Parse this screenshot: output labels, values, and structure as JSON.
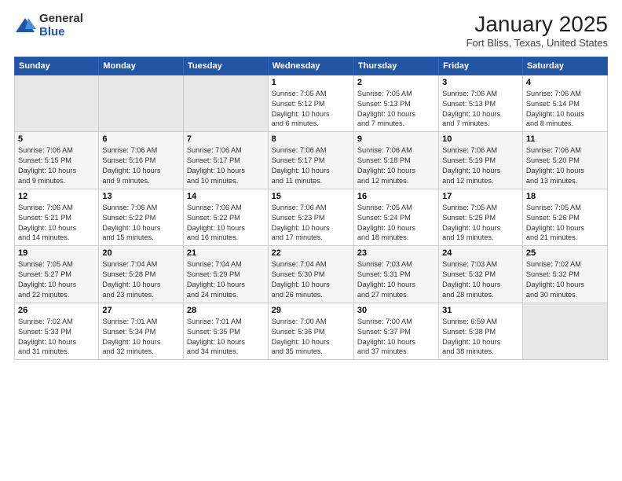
{
  "logo": {
    "general": "General",
    "blue": "Blue"
  },
  "title": "January 2025",
  "subtitle": "Fort Bliss, Texas, United States",
  "weekdays": [
    "Sunday",
    "Monday",
    "Tuesday",
    "Wednesday",
    "Thursday",
    "Friday",
    "Saturday"
  ],
  "weeks": [
    [
      {
        "num": "",
        "info": ""
      },
      {
        "num": "",
        "info": ""
      },
      {
        "num": "",
        "info": ""
      },
      {
        "num": "1",
        "info": "Sunrise: 7:05 AM\nSunset: 5:12 PM\nDaylight: 10 hours\nand 6 minutes."
      },
      {
        "num": "2",
        "info": "Sunrise: 7:05 AM\nSunset: 5:13 PM\nDaylight: 10 hours\nand 7 minutes."
      },
      {
        "num": "3",
        "info": "Sunrise: 7:06 AM\nSunset: 5:13 PM\nDaylight: 10 hours\nand 7 minutes."
      },
      {
        "num": "4",
        "info": "Sunrise: 7:06 AM\nSunset: 5:14 PM\nDaylight: 10 hours\nand 8 minutes."
      }
    ],
    [
      {
        "num": "5",
        "info": "Sunrise: 7:06 AM\nSunset: 5:15 PM\nDaylight: 10 hours\nand 9 minutes."
      },
      {
        "num": "6",
        "info": "Sunrise: 7:06 AM\nSunset: 5:16 PM\nDaylight: 10 hours\nand 9 minutes."
      },
      {
        "num": "7",
        "info": "Sunrise: 7:06 AM\nSunset: 5:17 PM\nDaylight: 10 hours\nand 10 minutes."
      },
      {
        "num": "8",
        "info": "Sunrise: 7:06 AM\nSunset: 5:17 PM\nDaylight: 10 hours\nand 11 minutes."
      },
      {
        "num": "9",
        "info": "Sunrise: 7:06 AM\nSunset: 5:18 PM\nDaylight: 10 hours\nand 12 minutes."
      },
      {
        "num": "10",
        "info": "Sunrise: 7:06 AM\nSunset: 5:19 PM\nDaylight: 10 hours\nand 12 minutes."
      },
      {
        "num": "11",
        "info": "Sunrise: 7:06 AM\nSunset: 5:20 PM\nDaylight: 10 hours\nand 13 minutes."
      }
    ],
    [
      {
        "num": "12",
        "info": "Sunrise: 7:06 AM\nSunset: 5:21 PM\nDaylight: 10 hours\nand 14 minutes."
      },
      {
        "num": "13",
        "info": "Sunrise: 7:06 AM\nSunset: 5:22 PM\nDaylight: 10 hours\nand 15 minutes."
      },
      {
        "num": "14",
        "info": "Sunrise: 7:06 AM\nSunset: 5:22 PM\nDaylight: 10 hours\nand 16 minutes."
      },
      {
        "num": "15",
        "info": "Sunrise: 7:06 AM\nSunset: 5:23 PM\nDaylight: 10 hours\nand 17 minutes."
      },
      {
        "num": "16",
        "info": "Sunrise: 7:05 AM\nSunset: 5:24 PM\nDaylight: 10 hours\nand 18 minutes."
      },
      {
        "num": "17",
        "info": "Sunrise: 7:05 AM\nSunset: 5:25 PM\nDaylight: 10 hours\nand 19 minutes."
      },
      {
        "num": "18",
        "info": "Sunrise: 7:05 AM\nSunset: 5:26 PM\nDaylight: 10 hours\nand 21 minutes."
      }
    ],
    [
      {
        "num": "19",
        "info": "Sunrise: 7:05 AM\nSunset: 5:27 PM\nDaylight: 10 hours\nand 22 minutes."
      },
      {
        "num": "20",
        "info": "Sunrise: 7:04 AM\nSunset: 5:28 PM\nDaylight: 10 hours\nand 23 minutes."
      },
      {
        "num": "21",
        "info": "Sunrise: 7:04 AM\nSunset: 5:29 PM\nDaylight: 10 hours\nand 24 minutes."
      },
      {
        "num": "22",
        "info": "Sunrise: 7:04 AM\nSunset: 5:30 PM\nDaylight: 10 hours\nand 26 minutes."
      },
      {
        "num": "23",
        "info": "Sunrise: 7:03 AM\nSunset: 5:31 PM\nDaylight: 10 hours\nand 27 minutes."
      },
      {
        "num": "24",
        "info": "Sunrise: 7:03 AM\nSunset: 5:32 PM\nDaylight: 10 hours\nand 28 minutes."
      },
      {
        "num": "25",
        "info": "Sunrise: 7:02 AM\nSunset: 5:32 PM\nDaylight: 10 hours\nand 30 minutes."
      }
    ],
    [
      {
        "num": "26",
        "info": "Sunrise: 7:02 AM\nSunset: 5:33 PM\nDaylight: 10 hours\nand 31 minutes."
      },
      {
        "num": "27",
        "info": "Sunrise: 7:01 AM\nSunset: 5:34 PM\nDaylight: 10 hours\nand 32 minutes."
      },
      {
        "num": "28",
        "info": "Sunrise: 7:01 AM\nSunset: 5:35 PM\nDaylight: 10 hours\nand 34 minutes."
      },
      {
        "num": "29",
        "info": "Sunrise: 7:00 AM\nSunset: 5:36 PM\nDaylight: 10 hours\nand 35 minutes."
      },
      {
        "num": "30",
        "info": "Sunrise: 7:00 AM\nSunset: 5:37 PM\nDaylight: 10 hours\nand 37 minutes."
      },
      {
        "num": "31",
        "info": "Sunrise: 6:59 AM\nSunset: 5:38 PM\nDaylight: 10 hours\nand 38 minutes."
      },
      {
        "num": "",
        "info": ""
      }
    ]
  ]
}
